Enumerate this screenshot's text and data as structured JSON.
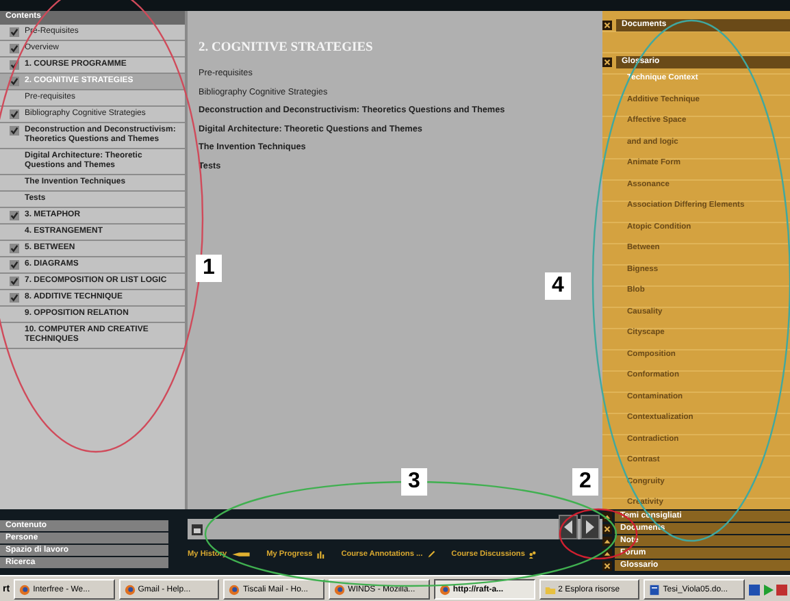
{
  "sidebar": {
    "title": "Contents",
    "items": [
      {
        "label": "Pre-Requisites",
        "checked": true,
        "bold": false,
        "selected": false
      },
      {
        "label": "Overview",
        "checked": true,
        "bold": false,
        "selected": false
      },
      {
        "label": "1. COURSE PROGRAMME",
        "checked": true,
        "bold": true,
        "selected": false
      },
      {
        "label": "2. COGNITIVE STRATEGIES",
        "checked": true,
        "bold": true,
        "selected": true,
        "children": [
          {
            "label": "Pre-requisites",
            "checked": false,
            "bold": false,
            "selected": false
          },
          {
            "label": "Bibliography Cognitive Strategies",
            "checked": true,
            "bold": false,
            "selected": false
          },
          {
            "label": "Deconstruction and Deconstructivism: Theoretics Questions and Themes",
            "checked": true,
            "bold": true,
            "selected": false
          },
          {
            "label": "Digital Architecture: Theoretic Questions and Themes",
            "checked": false,
            "bold": true,
            "selected": false
          },
          {
            "label": "The Invention Techniques",
            "checked": false,
            "bold": true,
            "selected": false
          },
          {
            "label": "Tests",
            "checked": false,
            "bold": true,
            "selected": false
          }
        ]
      },
      {
        "label": "3. METAPHOR",
        "checked": true,
        "bold": true,
        "selected": false
      },
      {
        "label": "4. ESTRANGEMENT",
        "checked": false,
        "bold": true,
        "selected": false
      },
      {
        "label": "5. BETWEEN",
        "checked": true,
        "bold": true,
        "selected": false
      },
      {
        "label": "6. DIAGRAMS",
        "checked": true,
        "bold": true,
        "selected": false
      },
      {
        "label": "7. DECOMPOSITION OR LIST LOGIC",
        "checked": true,
        "bold": true,
        "selected": false
      },
      {
        "label": "8. ADDITIVE TECHNIQUE",
        "checked": true,
        "bold": true,
        "selected": false
      },
      {
        "label": "9. OPPOSITION RELATION",
        "checked": false,
        "bold": true,
        "selected": false
      },
      {
        "label": "10. COMPUTER AND CREATIVE TECHNIQUES",
        "checked": false,
        "bold": true,
        "selected": false
      }
    ]
  },
  "content": {
    "heading": "2. COGNITIVE STRATEGIES",
    "links": [
      {
        "label": "Pre-requisites",
        "bold": false
      },
      {
        "label": "Bibliography Cognitive Strategies",
        "bold": false
      },
      {
        "label": "Deconstruction and Deconstructivism: Theoretics Questions and Themes",
        "bold": true
      },
      {
        "label": "Digital Architecture: Theoretic Questions and Themes",
        "bold": true
      },
      {
        "label": "The Invention Techniques",
        "bold": true
      },
      {
        "label": "Tests",
        "bold": true
      }
    ]
  },
  "right_panel": {
    "documents": {
      "title": "Documents",
      "open": true
    },
    "glossary": {
      "title": "Glossario",
      "open": true,
      "items": [
        {
          "label": "Technique Context",
          "selected": true
        },
        {
          "label": "Additive Technique",
          "selected": false
        },
        {
          "label": "Affective Space",
          "selected": false
        },
        {
          "label": "and and logic",
          "selected": false
        },
        {
          "label": "Animate Form",
          "selected": false
        },
        {
          "label": "Assonance",
          "selected": false
        },
        {
          "label": "Association Differing Elements",
          "selected": false
        },
        {
          "label": "Atopic Condition",
          "selected": false
        },
        {
          "label": "Between",
          "selected": false
        },
        {
          "label": "Bigness",
          "selected": false
        },
        {
          "label": "Blob",
          "selected": false
        },
        {
          "label": "Causality",
          "selected": false
        },
        {
          "label": "Cityscape",
          "selected": false
        },
        {
          "label": "Composition",
          "selected": false
        },
        {
          "label": "Conformation",
          "selected": false
        },
        {
          "label": "Contamination",
          "selected": false
        },
        {
          "label": "Contextualization",
          "selected": false
        },
        {
          "label": "Contradiction",
          "selected": false
        },
        {
          "label": "Contrast",
          "selected": false
        },
        {
          "label": "Congruity",
          "selected": false
        },
        {
          "label": "Creativity",
          "selected": false
        }
      ]
    }
  },
  "bottom_menu": [
    "Contenuto",
    "Persone",
    "Spazio di lavoro",
    "Ricerca"
  ],
  "toolbar": [
    {
      "label": "My History",
      "kind": "history"
    },
    {
      "label": "My Progress",
      "kind": "progress"
    },
    {
      "label": "Course Annotations ...",
      "kind": "annotations"
    },
    {
      "label": "Course Discussions",
      "kind": "discussions"
    }
  ],
  "right_menu": [
    {
      "label": "Temi consigliati",
      "open": false
    },
    {
      "label": "Documents",
      "open": true
    },
    {
      "label": "Note",
      "open": false
    },
    {
      "label": "Forum",
      "open": false
    },
    {
      "label": "Glossario",
      "open": true
    }
  ],
  "annotations": [
    {
      "label": "1",
      "color": "#d04a5a"
    },
    {
      "label": "2",
      "color": "#d02030"
    },
    {
      "label": "3",
      "color": "#40b050"
    },
    {
      "label": "4",
      "color": "#40a8a0"
    }
  ],
  "taskbar": {
    "start": "rt",
    "items": [
      {
        "label": "Interfree - We...",
        "selected": false,
        "kind": "browser"
      },
      {
        "label": "Gmail - Help...",
        "selected": false,
        "kind": "browser"
      },
      {
        "label": "Tiscali Mail - Ho...",
        "selected": false,
        "kind": "browser"
      },
      {
        "label": "WINDS - Mozilla...",
        "selected": false,
        "kind": "browser"
      },
      {
        "label": "http://raft-a...",
        "selected": true,
        "kind": "browser"
      },
      {
        "label": "2 Esplora risorse",
        "selected": false,
        "kind": "folder"
      },
      {
        "label": "Tesi_Viola05.do...",
        "selected": false,
        "kind": "document"
      }
    ]
  }
}
